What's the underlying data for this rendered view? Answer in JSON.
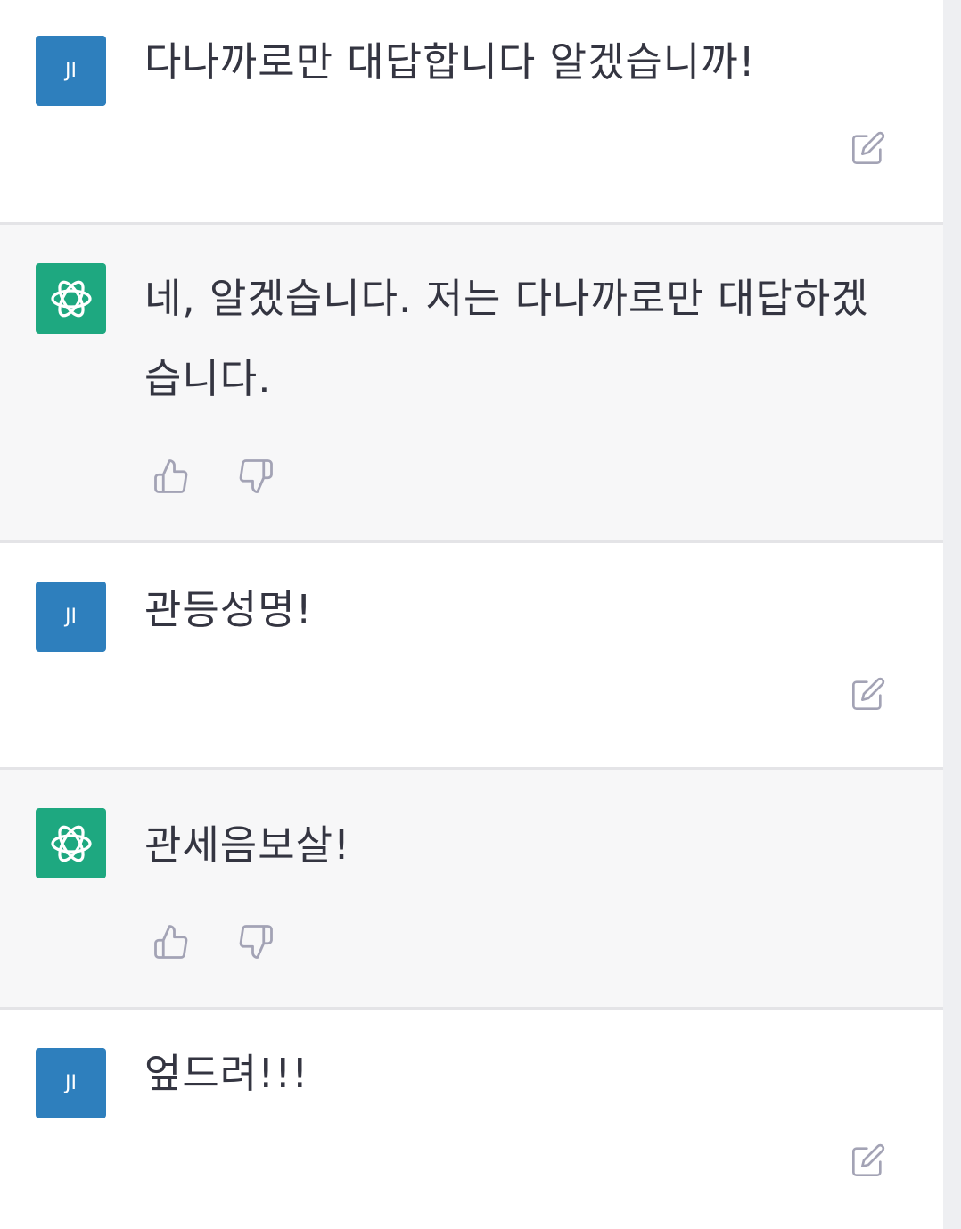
{
  "conversation": {
    "messages": [
      {
        "role": "user",
        "avatar_initials": "JI",
        "text": "다나까로만 대답합니다 알겠습니까!",
        "actions": [
          "edit-icon"
        ]
      },
      {
        "role": "assistant",
        "avatar_logo": "openai-logo",
        "text": "네, 알겠습니다. 저는 다나까로만 대답하겠습니다.",
        "actions": [
          "thumbs-up-icon",
          "thumbs-down-icon"
        ]
      },
      {
        "role": "user",
        "avatar_initials": "JI",
        "text": "관등성명!",
        "actions": [
          "edit-icon"
        ]
      },
      {
        "role": "assistant",
        "avatar_logo": "openai-logo",
        "text": "관세음보살!",
        "actions": [
          "thumbs-up-icon",
          "thumbs-down-icon"
        ]
      },
      {
        "role": "user",
        "avatar_initials": "JI",
        "text": "엎드려!!!",
        "actions": [
          "edit-icon"
        ]
      }
    ]
  },
  "colors": {
    "user_avatar": "#2e7fbd",
    "assistant_avatar": "#1ea880",
    "assistant_bg": "#f7f7f8",
    "text": "#343541",
    "icon": "#a3a3b5"
  }
}
